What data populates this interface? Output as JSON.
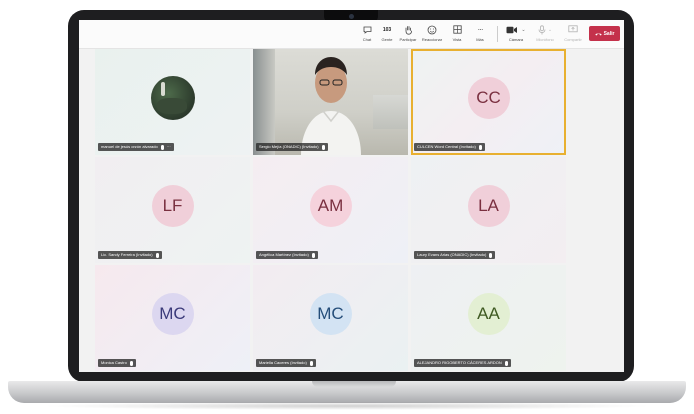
{
  "toolbar": {
    "buttons": [
      {
        "label": "Chat",
        "icon": "chat-icon"
      },
      {
        "label": "Gente",
        "icon": "people-icon",
        "count": "103"
      },
      {
        "label": "Participar",
        "icon": "raise-hand-icon"
      },
      {
        "label": "Reaccionar",
        "icon": "react-icon"
      },
      {
        "label": "Vista",
        "icon": "view-icon"
      },
      {
        "label": "Más",
        "icon": "more-icon"
      },
      {
        "label": "Cámara",
        "icon": "camera-icon"
      },
      {
        "label": "Micrófono",
        "icon": "mic-icon"
      },
      {
        "label": "Compartir",
        "icon": "share-icon"
      }
    ],
    "leave_label": "Salir"
  },
  "participants": [
    {
      "name": "manuel de jesús orzón alvarado",
      "type": "photo"
    },
    {
      "name": "Sergio Mejía (ONADIC) (Invitado)",
      "type": "video"
    },
    {
      "name": "CULCEN Word Central (Invitado)",
      "initials": "CC",
      "avatar_color": "#f0cfd9",
      "active": true
    },
    {
      "name": "Lic. Sandy Ferreira (Invitado)",
      "initials": "LF",
      "avatar_color": "#f0cfd9"
    },
    {
      "name": "Angélica Martínez (Invitado)",
      "initials": "AM",
      "avatar_color": "#f5d2dc"
    },
    {
      "name": "Laury Evans Arias (ONADIC) (Invitado)",
      "initials": "LA",
      "avatar_color": "#f0cfd9"
    },
    {
      "name": "Monica Castro",
      "initials": "MC",
      "avatar_color": "#dcd7f0"
    },
    {
      "name": "Mariella Caceres (Invitado)",
      "initials": "MC",
      "avatar_color": "#d3e3f3"
    },
    {
      "name": "ALEJANDRO RIGOBERTO CÁCERES ARDON",
      "initials": "AA",
      "avatar_color": "#e3efd3"
    }
  ],
  "colors": {
    "leave": "#c4314b",
    "active_outline": "#e8b030",
    "bezel": "#1e1e20"
  }
}
